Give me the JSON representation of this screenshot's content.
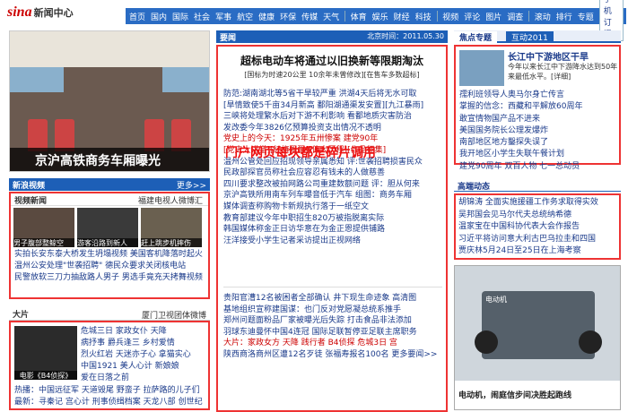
{
  "header": {
    "logo": "sina",
    "logo_sub": "新闻中心",
    "subscribe": "手机订阅"
  },
  "nav": [
    "首页",
    "国内",
    "国际",
    "社会",
    "军事",
    "航空",
    "健康",
    "环保",
    "传媒",
    "天气",
    "体育",
    "娱乐",
    "财经",
    "科技",
    "视频",
    "评论",
    "图片",
    "调查",
    "滚动",
    "排行",
    "专题"
  ],
  "hero": {
    "caption": "京沪高铁商务车厢曝光"
  },
  "video": {
    "title": "新浪视频",
    "more": "更多>>",
    "tab": "视频新闻",
    "tab_right": "福建电视人微博汇",
    "thumbs": [
      "男子腹部整鲸空",
      "游客沿路到新人",
      "赶上跳步机摔伤"
    ],
    "links": [
      "实拍长安东泰大桥发生坍塌视频",
      "美国客机降落时起火",
      "温州公安处理\"世袭招聘\"",
      "德民众要求关闭核电站",
      "民警放软三刀力抽敌路人男子",
      "男选手竟充天拷舞视频"
    ]
  },
  "dapian": {
    "title": "大片",
    "right": "厦门卫视团体微博",
    "img_label": "电影《B4侦探》",
    "grid": [
      "危城三日",
      "家政女仆",
      "天降",
      "病抒事",
      "爵兵逢三",
      "乡村爱情",
      "烈火红岩",
      "天迷亦子心",
      "拿猫实心",
      "中国1921",
      "美人心计",
      "新娘娘",
      "爱在日落之前"
    ],
    "bottom": [
      "热播：中国远征军",
      "天道毁尾",
      "野蛮子",
      "拉萨路的儿子们",
      "最新：寻秦记",
      "宫心计",
      "刑事侦缉档案",
      "天龙八部",
      "创世纪"
    ]
  },
  "yaowen": {
    "title": "要闻",
    "time": "北京时间：2011.05.30"
  },
  "headline": "超标电动车将通过以旧换新等限期淘汰",
  "subhead": "[国标为时速20公里 10余年未曾修改][在售车多数超标]",
  "overlay": "门户网页每块都是碎片调用",
  "mid_links": [
    "防范:湖南湖北等5省干旱较严重 洪湖4天后将无水可取",
    "[旱情致使5千亩34月新高 鄱阳湖通渠发安置][九江暴雨]",
    "三峡将处理繁水后对下游不利影响 看鄱地质灾害防治",
    "发改委今年3826亿预算投资支出情况不透明",
    "党史上的今天：1925年五卅惨案 建党90年",
    "[党史大讲堂][红旗飘飘][伟大历程][作品征集]",
    "温州公管处回应招现领导亲属悉知 评:世袭招聘损害民众",
    "民政部探官员称社会应容忍有钱未的人做慈善",
    "四川要求整改被拍网路公司重建数额问题 评：胆从何来",
    "京沪高铁所用南车列车曝音低于汽车 组图：商务车厢",
    "媒体调查称购物卡新规执行落于一纸空文",
    "教育部建议今年中职招生820万被指脱离实际",
    "韩国媒体称金正日访华意在为金正恩提供铺路",
    "汪洋接受小学生记者采访提出正视网络"
  ],
  "mid_links2": [
    "贵阳官漕12名被困者全部确认 井下现生命迹象 高清图",
    "基地组织宣称建国谋：也门反对党愿凝总统系推手",
    "郑州问题面粉品厂家被曝光后失踪 打击食品非法添加",
    "羽球东迪曼怀中国4连冠 国际足联暂停亚足联主席职务",
    "大片：家政女方 天降 践行者 B4侦探 危城3日 宫",
    "陕西商洛商州区遭12名歹徒 张福寿报名100名 更多要闻>>"
  ],
  "right": {
    "tab_on": "焦点专题",
    "tab_off": "互动2011",
    "feat_title": "长江中下游地区干旱",
    "feat_desc": "今年以来长江中下游降水达到50年来最低水平。[详细]",
    "list": [
      "孺利班领导人奥马尔身亡传言",
      "掌握的信念：西藏和平解放60周年",
      "敢宣情物国产品不进来",
      "美国国务院长公理发爆炸",
      "南部地区地方鑿探失误了",
      "我开地区小学生失联午餐计划",
      "建党90周年 双百人物 七一总动员"
    ],
    "gf_title": "高端动态",
    "gf_links": [
      "胡锦涛 全面实施援疆工作务求取得实效",
      "吴邦国会见马尔代夫总统纳希德",
      "温家宝在中国科协代表大会作报告",
      "习近平将访问意大利古巴乌拉圭和四国",
      "贾庆林5月24日至25日在上海考察"
    ],
    "ad_label": "电动机，闹庭信步间决胜起跑线",
    "ad_logo": "电动机"
  },
  "colors": {
    "nav": "#2a6cc4",
    "highlight": "#e33333",
    "link": "#1a3a8a",
    "headline_red": "#cc0000"
  }
}
